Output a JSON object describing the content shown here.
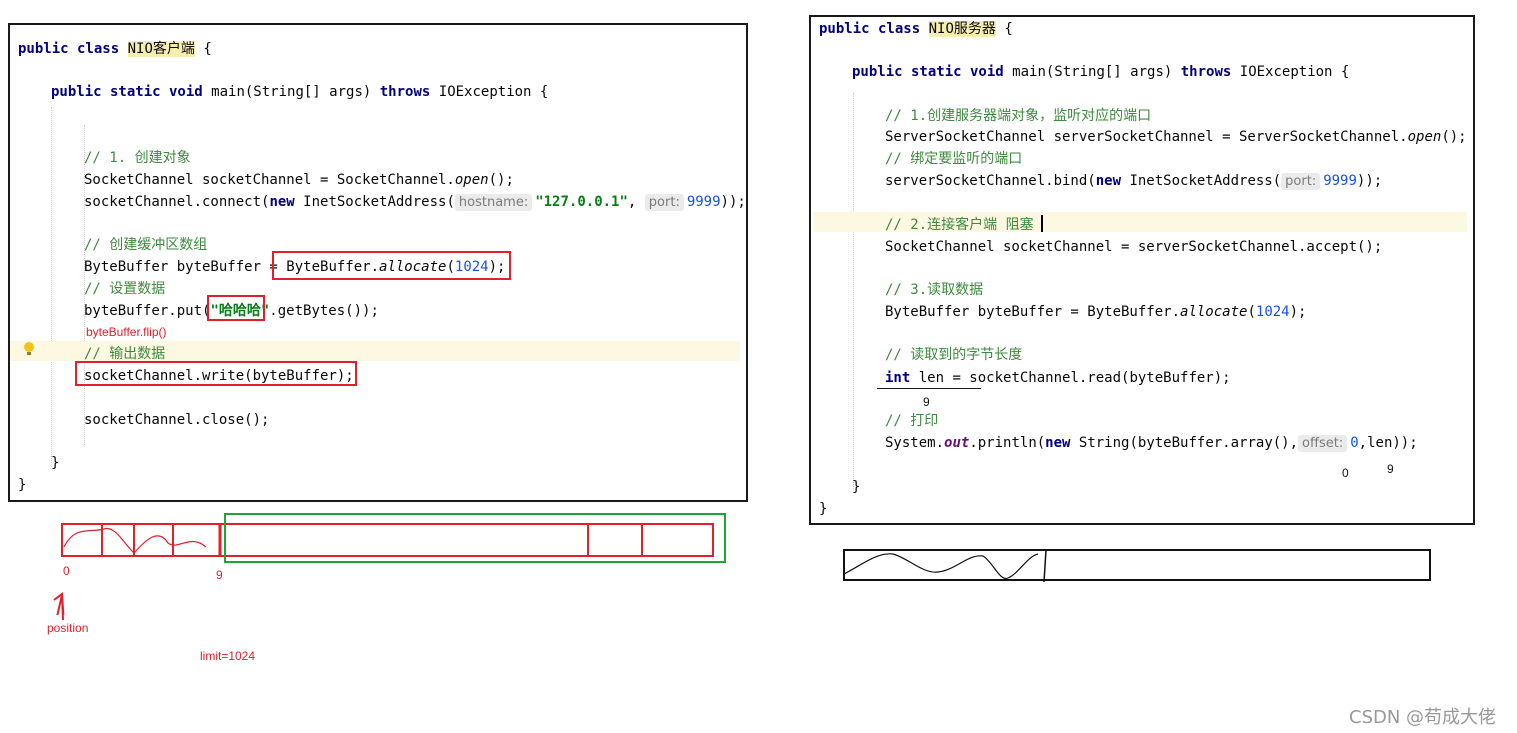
{
  "client": {
    "class_kw": "public class",
    "class_name": "NIO客户端",
    "open_brace": "{",
    "main_sig_kw": "public static void",
    "main_sig_rest": "main(String[] args)",
    "throws_kw": "throws",
    "exception": "IOException {",
    "c1": "// 1. 创建对象",
    "l_open_a": "SocketChannel socketChannel = SocketChannel.",
    "l_open_b": "open",
    "l_open_c": "();",
    "l_conn_a": "socketChannel.connect(",
    "l_conn_new": "new",
    "l_conn_b": " InetSocketAddress(",
    "hint_hostname": "hostname:",
    "host_value": "\"127.0.0.1\"",
    "comma": ",",
    "hint_port": "port:",
    "port_value": "9999",
    "l_conn_end": "));",
    "c2": "// 创建缓冲区数组",
    "l_alloc_a": "ByteBuffer byteBuffer = ",
    "l_alloc_b": "ByteBuffer.",
    "l_alloc_c": "allocate",
    "l_alloc_d": "(",
    "alloc_size": "1024",
    "l_alloc_e": ");",
    "c3": "// 设置数据",
    "l_put_a": "byteBuffer.put(",
    "put_value": "\"哈哈哈\"",
    "l_put_b": ".getBytes());",
    "annotation_flip": "byteBuffer.flip()",
    "c4": "// 输出数据",
    "l_write": "socketChannel.write(byteBuffer);",
    "l_close": "socketChannel.close();",
    "close_inner": "}",
    "close_outer": "}"
  },
  "server": {
    "class_kw": "public class",
    "class_name": "NIO服务器",
    "open_brace": "{",
    "main_sig_kw": "public static void",
    "main_sig_rest": "main(String[] args)",
    "throws_kw": "throws",
    "exception": "IOException {",
    "c1": "// 1.创建服务器端对象，监听对应的端口",
    "l_ssc_a": "ServerSocketChannel serverSocketChannel = ServerSocketChannel.",
    "l_ssc_b": "open",
    "l_ssc_c": "();",
    "c2": "// 绑定要监听的端口",
    "l_bind_a": "serverSocketChannel.bind(",
    "l_bind_new": "new",
    "l_bind_b": " InetSocketAddress(",
    "hint_port": "port:",
    "port_value": "9999",
    "l_bind_end": "));",
    "c3": "// 2.连接客户端 阻塞",
    "l_accept": "SocketChannel socketChannel = serverSocketChannel.accept();",
    "c4": "// 3.读取数据",
    "l_alloc_a": "ByteBuffer byteBuffer = ByteBuffer.",
    "l_alloc_b": "allocate",
    "l_alloc_c": "(",
    "alloc_size": "1024",
    "l_alloc_d": ");",
    "c5": "// 读取到的字节长度",
    "l_read_kw": "int",
    "l_read_rest": " len = socketChannel.read(byteBuffer);",
    "anno_9": "9",
    "c6": "// 打印",
    "l_print_a": "System.",
    "l_print_out": "out",
    "l_print_b": ".println(",
    "l_print_new": "new",
    "l_print_c": " String(byteBuffer.array(),",
    "hint_offset": "offset:",
    "offset_value": "0",
    "l_print_d": ",len));",
    "anno_0": "0",
    "anno_9b": "9",
    "close_inner": "}",
    "close_outer": "}"
  },
  "diagram": {
    "label_0": "0",
    "label_9": "9",
    "label_position": "position",
    "label_limit": "limit=1024"
  },
  "watermark": "CSDN @苟成大佬",
  "colors": {
    "annotation_red": "#e0202a",
    "annotation_green": "#1fa632",
    "comment_green": "#3d8a3d",
    "keyword_navy": "#000080",
    "number_blue": "#1750eb"
  }
}
